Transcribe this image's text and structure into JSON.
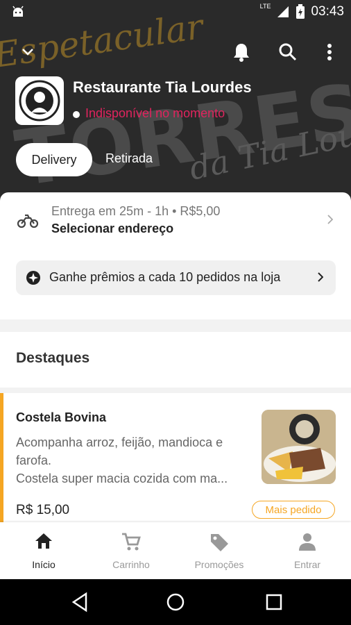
{
  "status_bar": {
    "time": "03:43",
    "network": "LTE"
  },
  "hero": {
    "bg_text_1": "Espetacular",
    "bg_text_2": "TORRESMÃO",
    "bg_text_3": "da Tia Lourdes",
    "restaurant_name": "Restaurante Tia Lourdes",
    "availability": "Indisponível no momento",
    "availability_color": "#e0245e"
  },
  "mode_tabs": [
    {
      "label": "Delivery",
      "active": true
    },
    {
      "label": "Retirada",
      "active": false
    }
  ],
  "delivery": {
    "line1": "Entrega em 25m - 1h • R$5,00",
    "line2": "Selecionar endereço"
  },
  "reward": {
    "text": "Ganhe prêmios a cada 10 pedidos na loja"
  },
  "section": {
    "title": "Destaques"
  },
  "featured_item": {
    "name": "Costela Bovina",
    "desc_line1": "Acompanha arroz, feijão, mandioca e",
    "desc_line2": "farofa.",
    "desc_line3": "Costela super macia cozida com ma...",
    "price": "R$ 15,00",
    "badge": "Mais pedido",
    "accent_color": "#f5a623"
  },
  "bottom_nav": [
    {
      "label": "Início",
      "icon": "home-icon",
      "active": true
    },
    {
      "label": "Carrinho",
      "icon": "cart-icon",
      "active": false
    },
    {
      "label": "Promoções",
      "icon": "tag-icon",
      "active": false
    },
    {
      "label": "Entrar",
      "icon": "person-icon",
      "active": false
    }
  ]
}
